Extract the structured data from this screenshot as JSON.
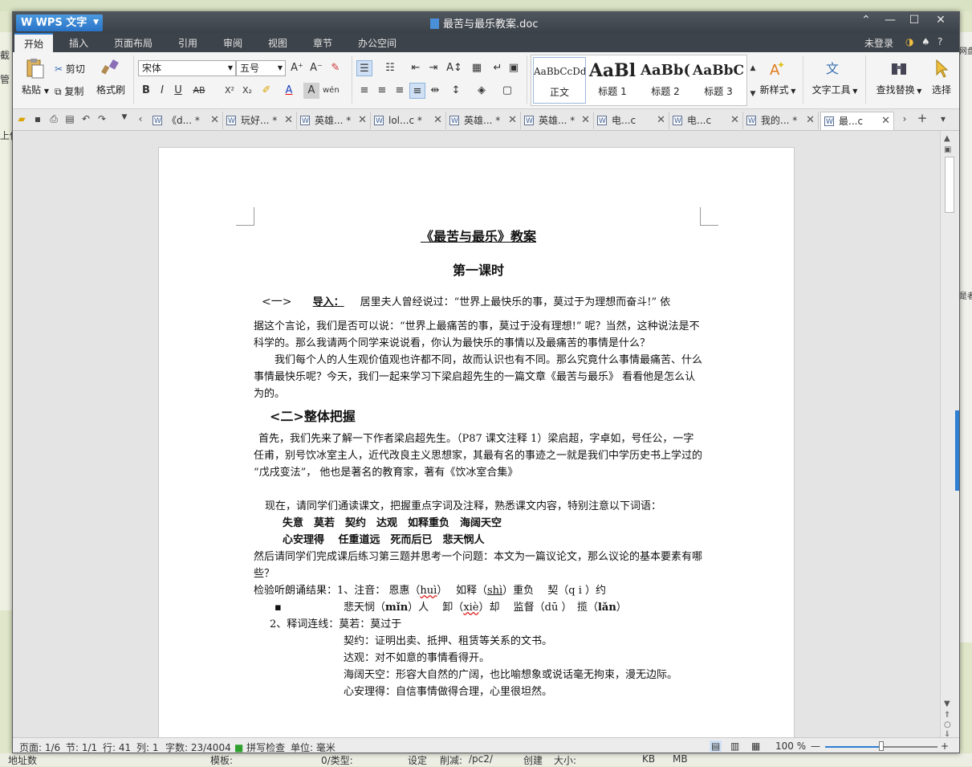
{
  "desktop": {
    "left_texts": [
      "截",
      "管",
      "上传"
    ],
    "right_text": "是者",
    "right_text_top": "网盘",
    "bottom_labels": [
      "地址数",
      "模板:",
      "0/类型:",
      "设定",
      "削减:",
      "/pc2/",
      "创建",
      "大小:",
      "KB",
      "MB"
    ]
  },
  "window": {
    "app_name": "WPS 文字",
    "doc_title": "最苦与最乐教案.doc",
    "controls": {
      "restore": "⌃",
      "minimize": "—",
      "maximize": "☐",
      "close": "✕"
    }
  },
  "menu": {
    "items": [
      "开始",
      "插入",
      "页面布局",
      "引用",
      "审阅",
      "视图",
      "章节",
      "办公空间"
    ],
    "active": "开始",
    "right": {
      "login": "未登录",
      "help": "?"
    }
  },
  "ribbon": {
    "paste": "粘贴",
    "cut": "剪切",
    "copy": "复制",
    "format_painter": "格式刷",
    "font_name": "宋体",
    "font_size": "五号",
    "styles": [
      {
        "preview": "AaBbCcDd",
        "label": "正文"
      },
      {
        "preview": "AaBl",
        "label": "标题 1"
      },
      {
        "preview": "AaBb(",
        "label": "标题 2"
      },
      {
        "preview": "AaBbC",
        "label": "标题 3"
      }
    ],
    "new_style": "新样式",
    "text_tools": "文字工具",
    "find_replace": "查找替换",
    "select": "选择"
  },
  "tabs": [
    {
      "label": "《d...",
      "dirty": "*"
    },
    {
      "label": "玩好...",
      "dirty": "*"
    },
    {
      "label": "英雄...",
      "dirty": "*"
    },
    {
      "label": "lol...c",
      "dirty": "*"
    },
    {
      "label": "英雄...",
      "dirty": "*"
    },
    {
      "label": "英雄...",
      "dirty": "*"
    },
    {
      "label": "电...c",
      "dirty": ""
    },
    {
      "label": "电...c",
      "dirty": ""
    },
    {
      "label": "我的...",
      "dirty": "*"
    },
    {
      "label": "最...c",
      "dirty": ""
    }
  ],
  "doc": {
    "title": "《最苦与最乐》教案",
    "lesson": "第一课时",
    "intro_num": "<一>",
    "intro_label": "导入：",
    "intro_line1": "居里夫人曾经说过：“世界上最快乐的事，莫过于为理想而奋斗!” 依",
    "intro_para": "据这个言论，我们是否可以说：“世界上最痛苦的事，莫过于没有理想!” 呢？当然，这种说法是不科学的。那么我请两个同学来说说看，你认为最快乐的事情以及最痛苦的事情是什么？",
    "para2": "我们每个人的人生观价值观也许都不同，故而认识也有不同。那么究竟什么事情最痛苦、什么事情最快乐呢？今天，我们一起来学习下梁启超先生的一篇文章《最苦与最乐》 看看他是怎么认为的。",
    "sec2": "<二>整体把握",
    "para3": "首先，我们先来了解一下作者梁启超先生。（P87 课文注释 1）梁启超，字卓如，号任公，一字任甫，别号饮冰室主人，近代改良主义思想家，其最有名的事迹之一就是我们中学历史书上学过的 “戊戌变法”， 他也是著名的教育家，著有《饮冰室合集》",
    "para4": "现在，请同学们通读课文，把握重点字词及注释，熟悉课文内容，特别注意以下词语：",
    "words1": "失意　莫若　契约　达观　如释重负　海阔天空",
    "words2": "心安理得　 任重道远　死而后已　悲天悯人",
    "para5": "然后请同学们完成课后练习第三题并思考一个问题：本文为一篇议论文，那么议论的基本要素有哪些？",
    "check_label": "检验听朗诵结果：",
    "check1": "1、注音：  恩惠（",
    "hui": "huì",
    "check1b": "）　 如释（",
    "shi": "shì",
    "check1c": "）重负　  契（q i ）约",
    "bullet": "▪",
    "check2a": "悲天悯（",
    "min": "mǐn",
    "check2b": "）人　 卸（",
    "xie": "xiè",
    "check2c": "）却　 监督（dū ）　揽（",
    "lan": "lǎn",
    "check2d": "）",
    "def_label": "2、释词连线：",
    "def1": "莫若：莫过于",
    "def2": "契约：证明出卖、抵押、租赁等关系的文书。",
    "def3": "达观：对不如意的事情看得开。",
    "def4": "海阔天空：形容大自然的广阔，也比喻想象或说话毫无拘束，漫无边际。",
    "def5": "心安理得：自信事情做得合理，心里很坦然。"
  },
  "status": {
    "page": "页面: 1/6",
    "section": "节: 1/1",
    "row": "行: 41",
    "col": "列: 1",
    "words": "字数: 23/4004",
    "spell": "拼写检查",
    "unit": "单位: 毫米",
    "zoom": "100 %",
    "zoom_level": 0.5
  },
  "colors": {
    "accent": "#2f7fd1",
    "titlebar": "#3d434a"
  }
}
